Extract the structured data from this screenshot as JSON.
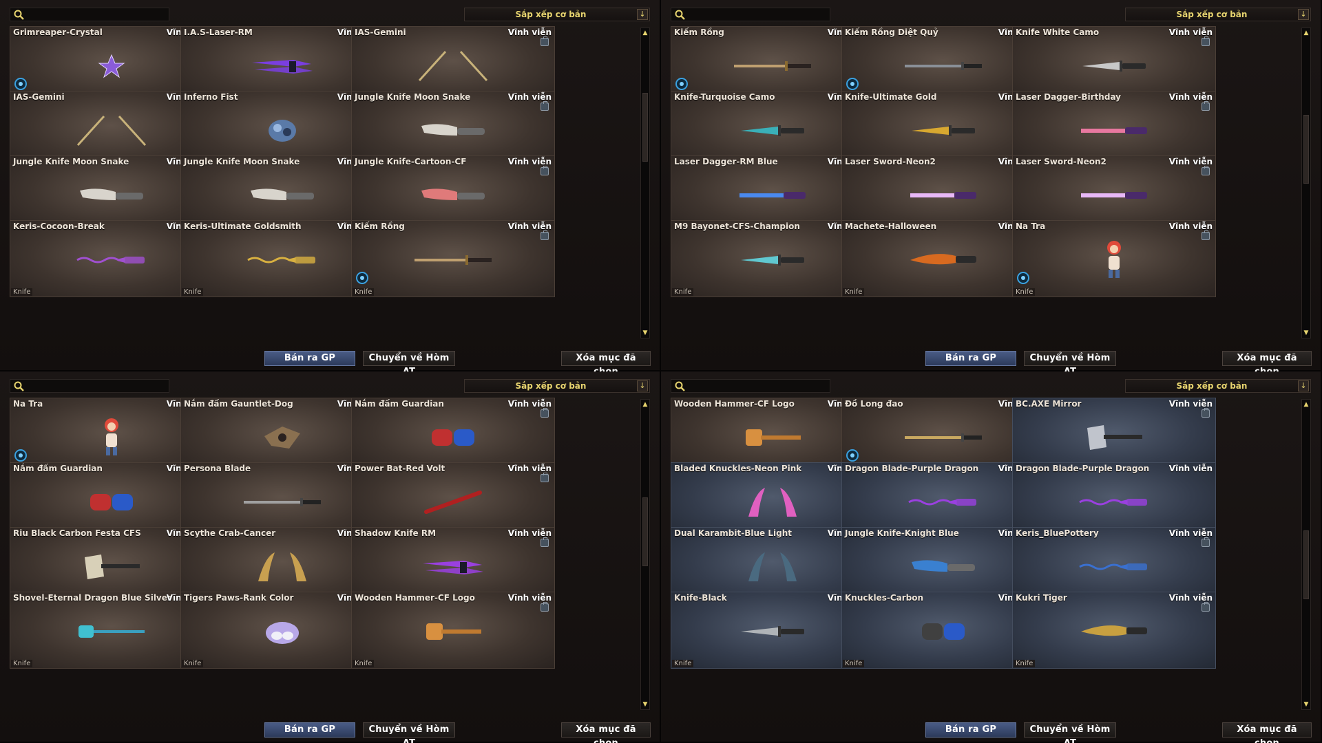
{
  "common": {
    "sort_label": "Sắp xếp cơ bản",
    "sort_arrow": "↓",
    "duration": "Vĩnh viễn",
    "type": "Knife",
    "sell_button": "Bán ra GP",
    "move_button": "Chuyển về Hòm AT",
    "delete_button": "Xóa mục đã chọn",
    "search_placeholder": ""
  },
  "panels": [
    {
      "items": [
        {
          "name": "Grimreaper-Crystal",
          "badge": true,
          "bag": false,
          "weapon": "star-blade",
          "color": "#8a5cd8"
        },
        {
          "name": "I.A.S-Laser-RM",
          "badge": false,
          "bag": true,
          "weapon": "dual-laser",
          "color": "#7a3ee0"
        },
        {
          "name": "IAS-Gemini",
          "badge": false,
          "bag": true,
          "weapon": "twin-spikes",
          "color": "#c8b27a"
        },
        {
          "name": "IAS-Gemini",
          "badge": false,
          "bag": true,
          "weapon": "twin-spikes",
          "color": "#c8b27a"
        },
        {
          "name": "Inferno Fist",
          "badge": false,
          "bag": true,
          "weapon": "fist",
          "color": "#5a7aa8"
        },
        {
          "name": "Jungle Knife Moon Snake",
          "badge": false,
          "bag": true,
          "weapon": "jungle-knife",
          "color": "#d8d4cc"
        },
        {
          "name": "Jungle Knife Moon Snake",
          "badge": false,
          "bag": true,
          "weapon": "jungle-knife",
          "color": "#d8d4cc"
        },
        {
          "name": "Jungle Knife Moon Snake",
          "badge": false,
          "bag": true,
          "weapon": "jungle-knife",
          "color": "#d8d4cc"
        },
        {
          "name": "Jungle Knife-Cartoon-CF",
          "badge": false,
          "bag": true,
          "weapon": "jungle-knife",
          "color": "#e07a7a"
        },
        {
          "name": "Keris-Cocoon-Break",
          "badge": false,
          "bag": false,
          "weapon": "keris",
          "color": "#a050d0"
        },
        {
          "name": "Keris-Ultimate Goldsmith",
          "badge": false,
          "bag": true,
          "weapon": "keris",
          "color": "#d8b040"
        },
        {
          "name": "Kiếm Rồng",
          "badge": true,
          "bag": true,
          "weapon": "sword",
          "color": "#c0a070"
        }
      ],
      "scroll_offset": 0.25
    },
    {
      "items": [
        {
          "name": "Kiếm Rồng",
          "badge": true,
          "bag": true,
          "weapon": "sword",
          "color": "#c0a070"
        },
        {
          "name": "Kiếm Rồng Diệt Quỷ",
          "badge": true,
          "bag": true,
          "weapon": "long-sword",
          "color": "#8a9098"
        },
        {
          "name": "Knife White Camo",
          "badge": false,
          "bag": true,
          "weapon": "combat-knife",
          "color": "#c8c8c8"
        },
        {
          "name": "Knife-Turquoise Camo",
          "badge": false,
          "bag": true,
          "weapon": "combat-knife",
          "color": "#3ab0b8"
        },
        {
          "name": "Knife-Ultimate Gold",
          "badge": false,
          "bag": true,
          "weapon": "combat-knife",
          "color": "#d8a830"
        },
        {
          "name": "Laser Dagger-Birthday",
          "badge": false,
          "bag": true,
          "weapon": "laser-dagger",
          "color": "#e878a0"
        },
        {
          "name": "Laser Dagger-RM Blue",
          "badge": false,
          "bag": true,
          "weapon": "laser-dagger",
          "color": "#4a8af0"
        },
        {
          "name": "Laser Sword-Neon2",
          "badge": false,
          "bag": true,
          "weapon": "laser-dagger",
          "color": "#e8b8f8"
        },
        {
          "name": "Laser Sword-Neon2",
          "badge": false,
          "bag": true,
          "weapon": "laser-dagger",
          "color": "#e8b8f8"
        },
        {
          "name": "M9 Bayonet-CFS-Champion",
          "badge": false,
          "bag": true,
          "weapon": "combat-knife",
          "color": "#60c8d0"
        },
        {
          "name": "Machete-Halloween",
          "badge": false,
          "bag": true,
          "weapon": "machete",
          "color": "#d86a20"
        },
        {
          "name": "Na Tra",
          "badge": true,
          "bag": true,
          "weapon": "figure",
          "color": "#e04a3a"
        }
      ],
      "scroll_offset": 0.35
    },
    {
      "items": [
        {
          "name": "Na Tra",
          "badge": true,
          "bag": true,
          "weapon": "figure",
          "color": "#e04a3a"
        },
        {
          "name": "Nắm đấm Gauntlet-Dog",
          "badge": false,
          "bag": true,
          "weapon": "gauntlet",
          "color": "#8a7050"
        },
        {
          "name": "Nắm đấm Guardian",
          "badge": false,
          "bag": true,
          "weapon": "gloves",
          "color": "#c03030"
        },
        {
          "name": "Nắm đấm Guardian",
          "badge": false,
          "bag": true,
          "weapon": "gloves",
          "color": "#c03030"
        },
        {
          "name": "Persona Blade",
          "badge": false,
          "bag": false,
          "weapon": "long-sword",
          "color": "#a0a0a0"
        },
        {
          "name": "Power Bat-Red Volt",
          "badge": false,
          "bag": true,
          "weapon": "bat",
          "color": "#b02020"
        },
        {
          "name": "Riu Black Carbon Festa CFS",
          "badge": false,
          "bag": true,
          "weapon": "axe",
          "color": "#d8d0b8"
        },
        {
          "name": "Scythe Crab-Cancer",
          "badge": false,
          "bag": true,
          "weapon": "claws",
          "color": "#c8a050"
        },
        {
          "name": "Shadow Knife RM",
          "badge": false,
          "bag": true,
          "weapon": "dual-laser",
          "color": "#9a40e0"
        },
        {
          "name": "Shovel-Eternal Dragon Blue Silver",
          "badge": false,
          "bag": false,
          "weapon": "shovel",
          "color": "#40c0d0"
        },
        {
          "name": "Tigers Paws-Rank Color",
          "badge": false,
          "bag": false,
          "weapon": "paws",
          "color": "#b8a8e8"
        },
        {
          "name": "Wooden Hammer-CF Logo",
          "badge": false,
          "bag": true,
          "weapon": "hammer",
          "color": "#d89040"
        }
      ],
      "scroll_offset": 0.4
    },
    {
      "items": [
        {
          "name": "Wooden Hammer-CF Logo",
          "badge": false,
          "bag": true,
          "weapon": "hammer",
          "color": "#d89040",
          "blue": false
        },
        {
          "name": "Đồ Long đao",
          "badge": true,
          "bag": true,
          "weapon": "long-sword",
          "color": "#c8a860",
          "blue": false
        },
        {
          "name": "BC.AXE Mirror",
          "badge": false,
          "bag": true,
          "weapon": "axe",
          "color": "#c0c4cc",
          "blue": true
        },
        {
          "name": "Bladed Knuckles-Neon Pink",
          "badge": false,
          "bag": true,
          "weapon": "claws",
          "color": "#e060c0",
          "blue": true
        },
        {
          "name": "Dragon Blade-Purple Dragon",
          "badge": false,
          "bag": true,
          "weapon": "keris",
          "color": "#9a40e0",
          "blue": true
        },
        {
          "name": "Dragon Blade-Purple Dragon",
          "badge": false,
          "bag": false,
          "weapon": "keris",
          "color": "#9a40e0",
          "blue": true
        },
        {
          "name": "Dual Karambit-Blue Light",
          "badge": false,
          "bag": true,
          "weapon": "claws",
          "color": "#4a6a80",
          "blue": true
        },
        {
          "name": "Jungle Knife-Knight Blue",
          "badge": false,
          "bag": true,
          "weapon": "jungle-knife",
          "color": "#3a80d0",
          "blue": true
        },
        {
          "name": "Keris_BluePottery",
          "badge": false,
          "bag": true,
          "weapon": "keris",
          "color": "#3a70d0",
          "blue": true
        },
        {
          "name": "Knife-Black",
          "badge": false,
          "bag": true,
          "weapon": "combat-knife",
          "color": "#b0b4b8",
          "blue": true
        },
        {
          "name": "Knuckles-Carbon",
          "badge": false,
          "bag": true,
          "weapon": "gloves",
          "color": "#404040",
          "blue": true
        },
        {
          "name": "Kukri Tiger",
          "badge": false,
          "bag": true,
          "weapon": "machete",
          "color": "#c8a040",
          "blue": true
        }
      ],
      "scroll_offset": 0.55
    }
  ]
}
